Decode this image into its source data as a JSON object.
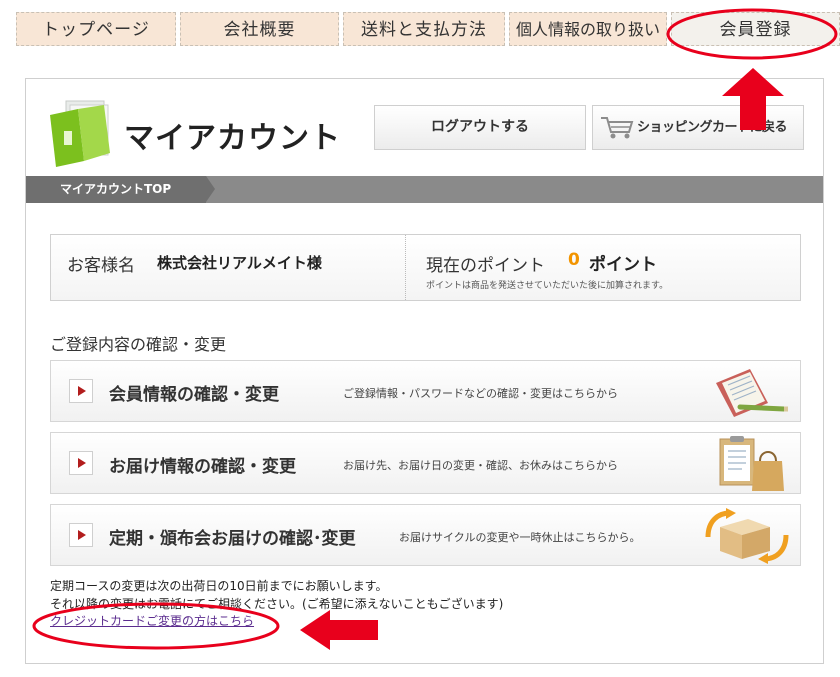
{
  "nav": {
    "tabs": [
      {
        "label": "トップページ"
      },
      {
        "label": "会社概要"
      },
      {
        "label": "送料と支払方法"
      },
      {
        "label": "個人情報の取り扱い"
      },
      {
        "label": "会員登録"
      }
    ]
  },
  "header": {
    "title": "マイアカウント",
    "logout_label": "ログアウトする",
    "cart_label": "ショッピングカートに戻る"
  },
  "breadcrumb": {
    "label": "マイアカウントTOP"
  },
  "customer": {
    "label": "お客様名",
    "name": "株式会社リアルメイト様",
    "points_label": "現在のポイント",
    "points_value": "0",
    "points_unit": "ポイント",
    "points_note": "ポイントは商品を発送させていただいた後に加算されます。"
  },
  "section": {
    "heading": "ご登録内容の確認・変更"
  },
  "menu": [
    {
      "title": "会員情報の確認・変更",
      "desc": "ご登録情報・パスワードなどの確認・変更はこちらから",
      "icon": "notebook-pen-icon"
    },
    {
      "title": "お届け情報の確認・変更",
      "desc": "お届け先、お届け日の変更・確認、お休みはこちらから",
      "icon": "clipboard-bag-icon"
    },
    {
      "title": "定期・頒布会お届けの確認･変更",
      "desc": "お届けサイクルの変更や一時休止はこちらから。",
      "icon": "boxes-cycle-icon"
    }
  ],
  "notes": {
    "line1": "定期コースの変更は次の出荷日の10日前までにお願いします。",
    "line2": "それ以降の変更はお電話にてご相談ください。(ご希望に添えないこともございます)",
    "cc_link": "クレジットカードご変更の方はこちら"
  },
  "colors": {
    "accent_orange": "#f29400",
    "annotation_red": "#e8001c",
    "play_red": "#b21d1d"
  }
}
